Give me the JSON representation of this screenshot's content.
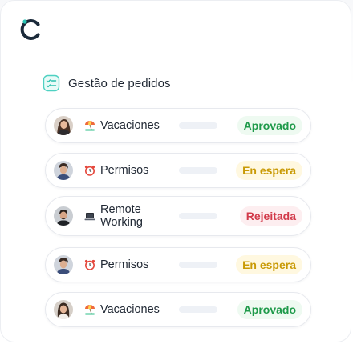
{
  "section": {
    "title": "Gestão de pedidos",
    "icon": "checklist-icon"
  },
  "colors": {
    "brand_dark": "#1b2a3a",
    "brand_teal": "#29c4b4",
    "approved_bg": "#eefaf1",
    "approved_fg": "#1e9a4a",
    "waiting_bg": "#fff8e0",
    "waiting_fg": "#c99a06",
    "rejected_bg": "#fdeef0",
    "rejected_fg": "#d23a4a"
  },
  "requests": [
    {
      "type_label": "Vacaciones",
      "type_icon": "beach-umbrella-icon",
      "status": "Aprovado"
    },
    {
      "type_label": "Permisos",
      "type_icon": "alarm-clock-icon",
      "status": "En espera"
    },
    {
      "type_label": "Remote Working",
      "type_icon": "laptop-icon",
      "status": "Rejeitada"
    },
    {
      "type_label": "Permisos",
      "type_icon": "alarm-clock-icon",
      "status": "En espera"
    },
    {
      "type_label": "Vacaciones",
      "type_icon": "beach-umbrella-icon",
      "status": "Aprovado"
    }
  ]
}
